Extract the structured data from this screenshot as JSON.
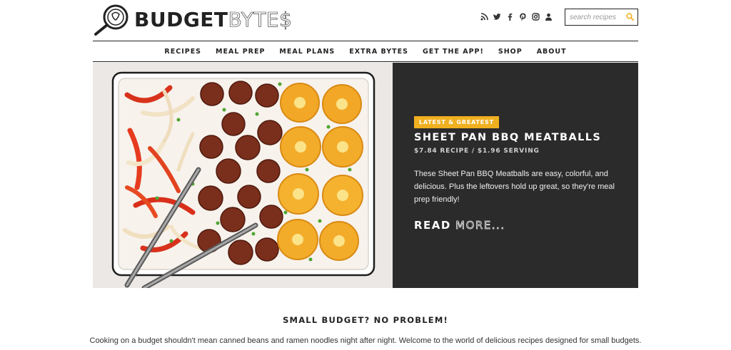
{
  "header": {
    "logo": {
      "word1": "BUDGET",
      "word2": "BYTE$",
      "icon": "frying-pan-logo-icon"
    },
    "social_icons": [
      "rss-icon",
      "twitter-icon",
      "facebook-icon",
      "pinterest-icon",
      "instagram-icon",
      "user-icon"
    ],
    "search": {
      "placeholder": "search recipes",
      "icon": "search-icon"
    }
  },
  "nav": {
    "items": [
      {
        "label": "RECIPES"
      },
      {
        "label": "MEAL PREP"
      },
      {
        "label": "MEAL PLANS"
      },
      {
        "label": "EXTRA BYTES"
      },
      {
        "label": "GET THE APP!"
      },
      {
        "label": "SHOP"
      },
      {
        "label": "ABOUT"
      }
    ]
  },
  "hero": {
    "badge": "LATEST & GREATEST",
    "title": "SHEET PAN BBQ MEATBALLS",
    "price": "$7.84 RECIPE / $1.96 SERVING",
    "description": "These Sheet Pan BBQ Meatballs are easy, colorful, and delicious. Plus the leftovers hold up great, so they're meal prep friendly!",
    "read_more_1": "READ",
    "read_more_2": "MORE..."
  },
  "tagline": {
    "heading": "SMALL BUDGET? NO PROBLEM!",
    "text": "Cooking on a budget shouldn't mean canned beans and ramen noodles night after night. Welcome to the world of delicious recipes designed for small budgets."
  },
  "colors": {
    "accent": "#f0b020",
    "dark_panel": "#2b2b2b",
    "text": "#222222"
  }
}
